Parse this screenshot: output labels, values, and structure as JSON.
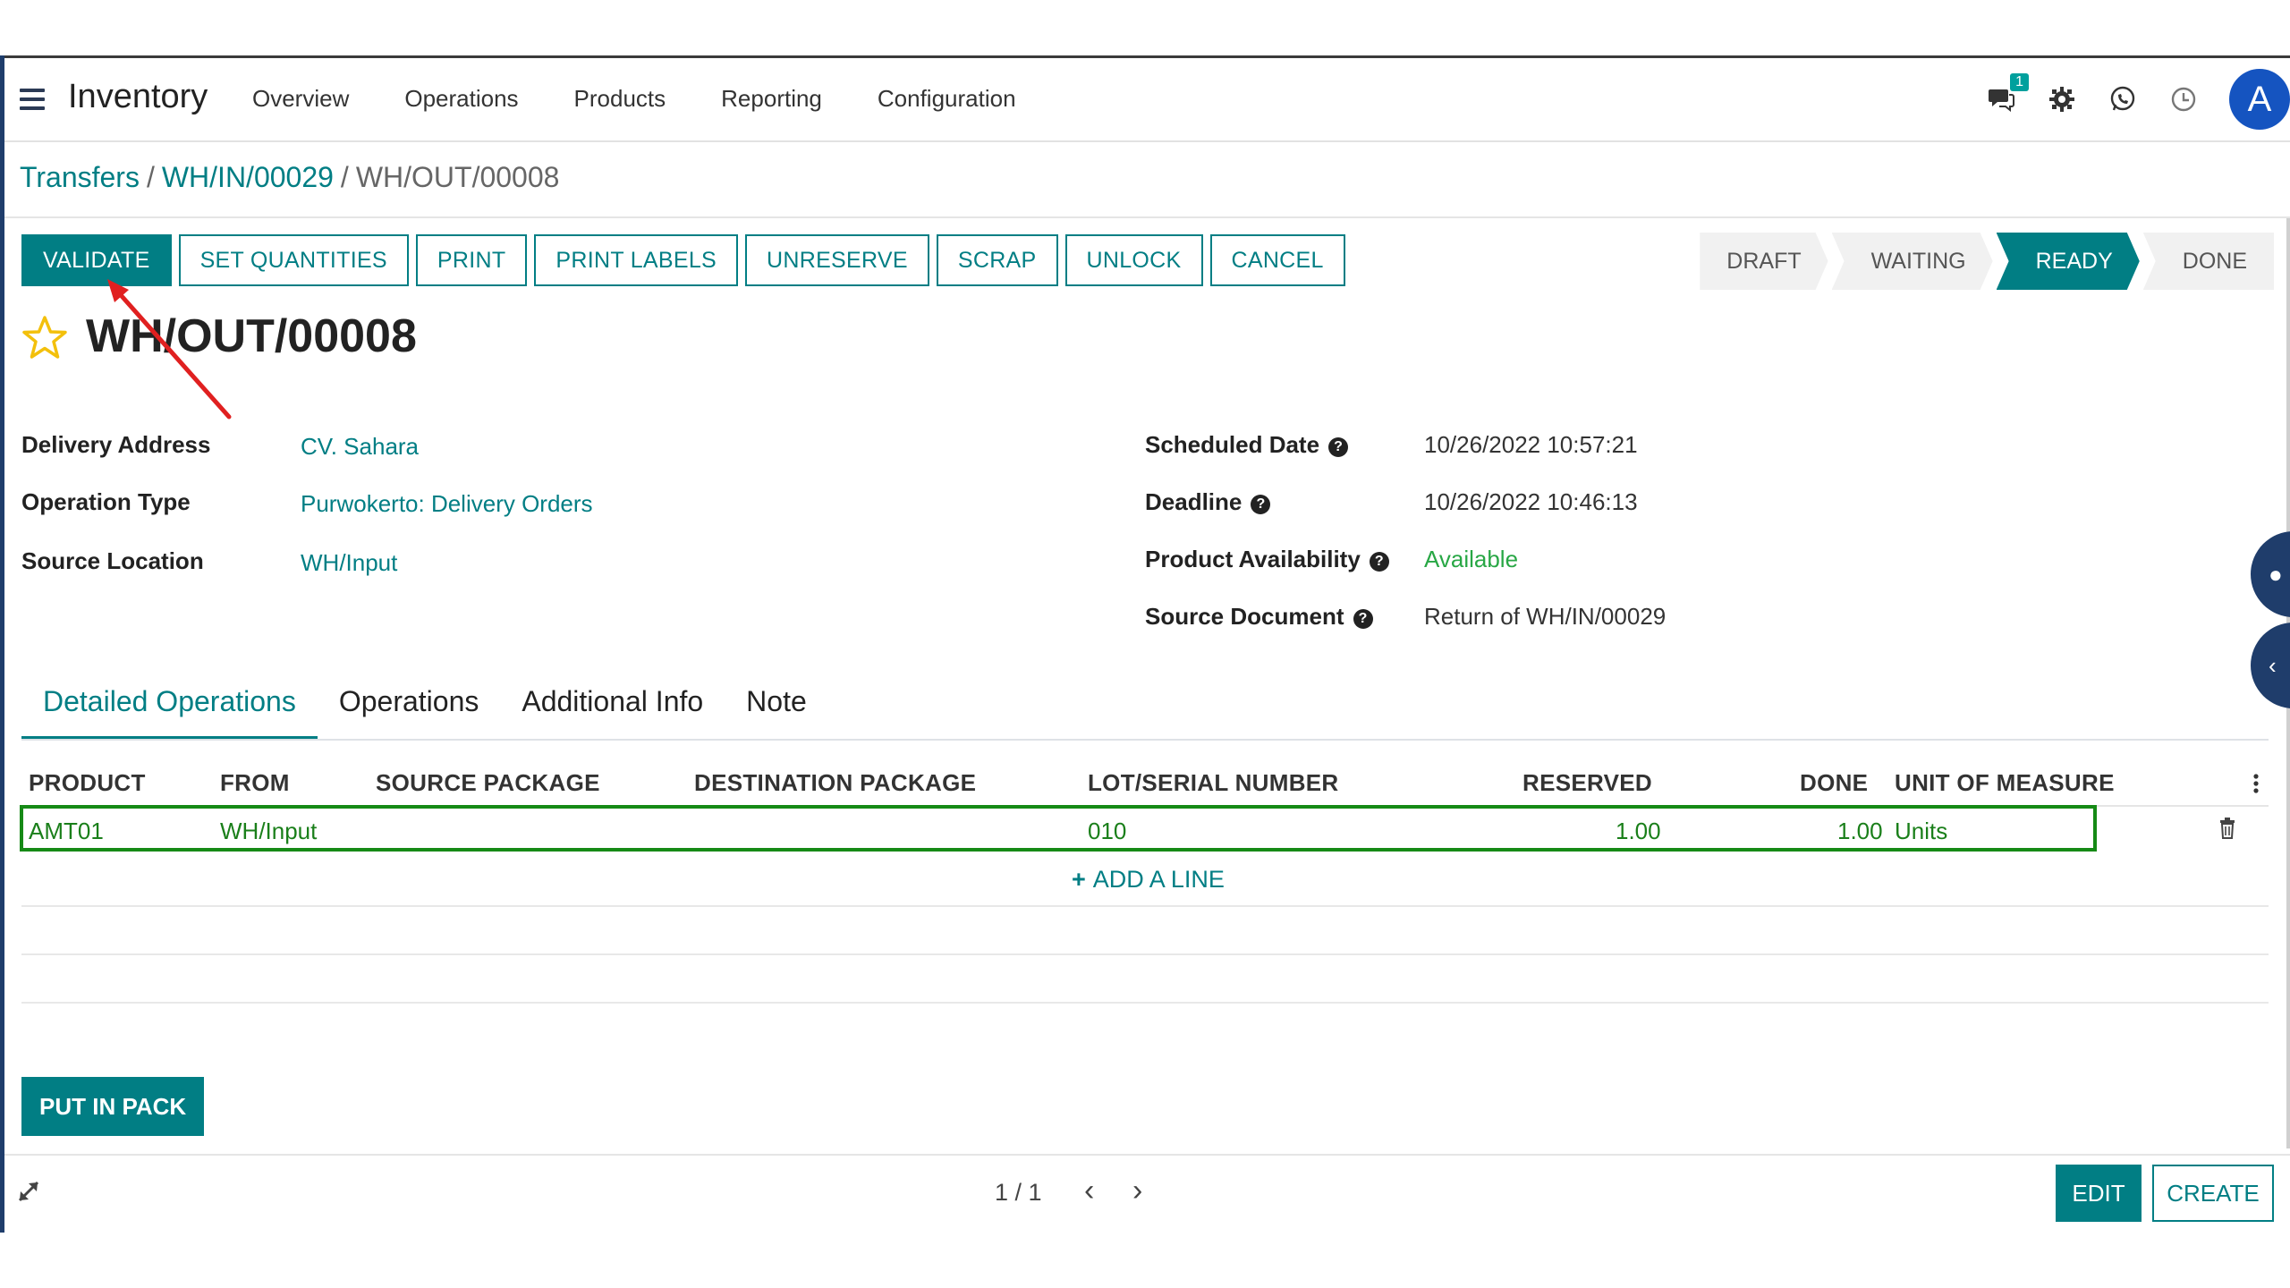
{
  "navbar": {
    "app_title": "Inventory",
    "menu": [
      "Overview",
      "Operations",
      "Products",
      "Reporting",
      "Configuration"
    ],
    "chat_badge": "1",
    "avatar_letter": "A"
  },
  "breadcrumb": {
    "transfers": "Transfers",
    "receipt": "WH/IN/00029",
    "current": "WH/OUT/00008"
  },
  "actions": {
    "validate": "VALIDATE",
    "set_quantities": "SET QUANTITIES",
    "print": "PRINT",
    "print_labels": "PRINT LABELS",
    "unreserve": "UNRESERVE",
    "scrap": "SCRAP",
    "unlock": "UNLOCK",
    "cancel": "CANCEL"
  },
  "status_bar": {
    "draft": "DRAFT",
    "waiting": "WAITING",
    "ready": "READY",
    "done": "DONE",
    "active": "READY"
  },
  "record": {
    "title": "WH/OUT/00008"
  },
  "fields": {
    "delivery_address_label": "Delivery Address",
    "delivery_address": "CV. Sahara",
    "operation_type_label": "Operation Type",
    "operation_type": "Purwokerto: Delivery Orders",
    "source_location_label": "Source Location",
    "source_location": "WH/Input",
    "scheduled_date_label": "Scheduled Date",
    "scheduled_date": "10/26/2022 10:57:21",
    "deadline_label": "Deadline",
    "deadline": "10/26/2022 10:46:13",
    "product_availability_label": "Product Availability",
    "product_availability": "Available",
    "source_document_label": "Source Document",
    "source_document": "Return of WH/IN/00029",
    "help_glyph": "?"
  },
  "tabs": [
    "Detailed Operations",
    "Operations",
    "Additional Info",
    "Note"
  ],
  "table": {
    "headers": {
      "product": "PRODUCT",
      "from": "FROM",
      "source_package": "SOURCE PACKAGE",
      "destination_package": "DESTINATION PACKAGE",
      "lot": "LOT/SERIAL NUMBER",
      "reserved": "RESERVED",
      "done": "DONE",
      "uom": "UNIT OF MEASURE"
    },
    "rows": [
      {
        "product": "AMT01",
        "from": "WH/Input",
        "source_package": "",
        "destination_package": "",
        "lot": "010",
        "reserved": "1.00",
        "done": "1.00",
        "uom": "Units"
      }
    ],
    "add_line": "ADD A LINE"
  },
  "put_in_pack": "PUT IN PACK",
  "footer": {
    "pager": "1 / 1",
    "edit": "EDIT",
    "create": "CREATE"
  },
  "colors": {
    "accent": "#017e84",
    "highlight_border": "#168a16",
    "annotation_arrow": "#e02020"
  }
}
